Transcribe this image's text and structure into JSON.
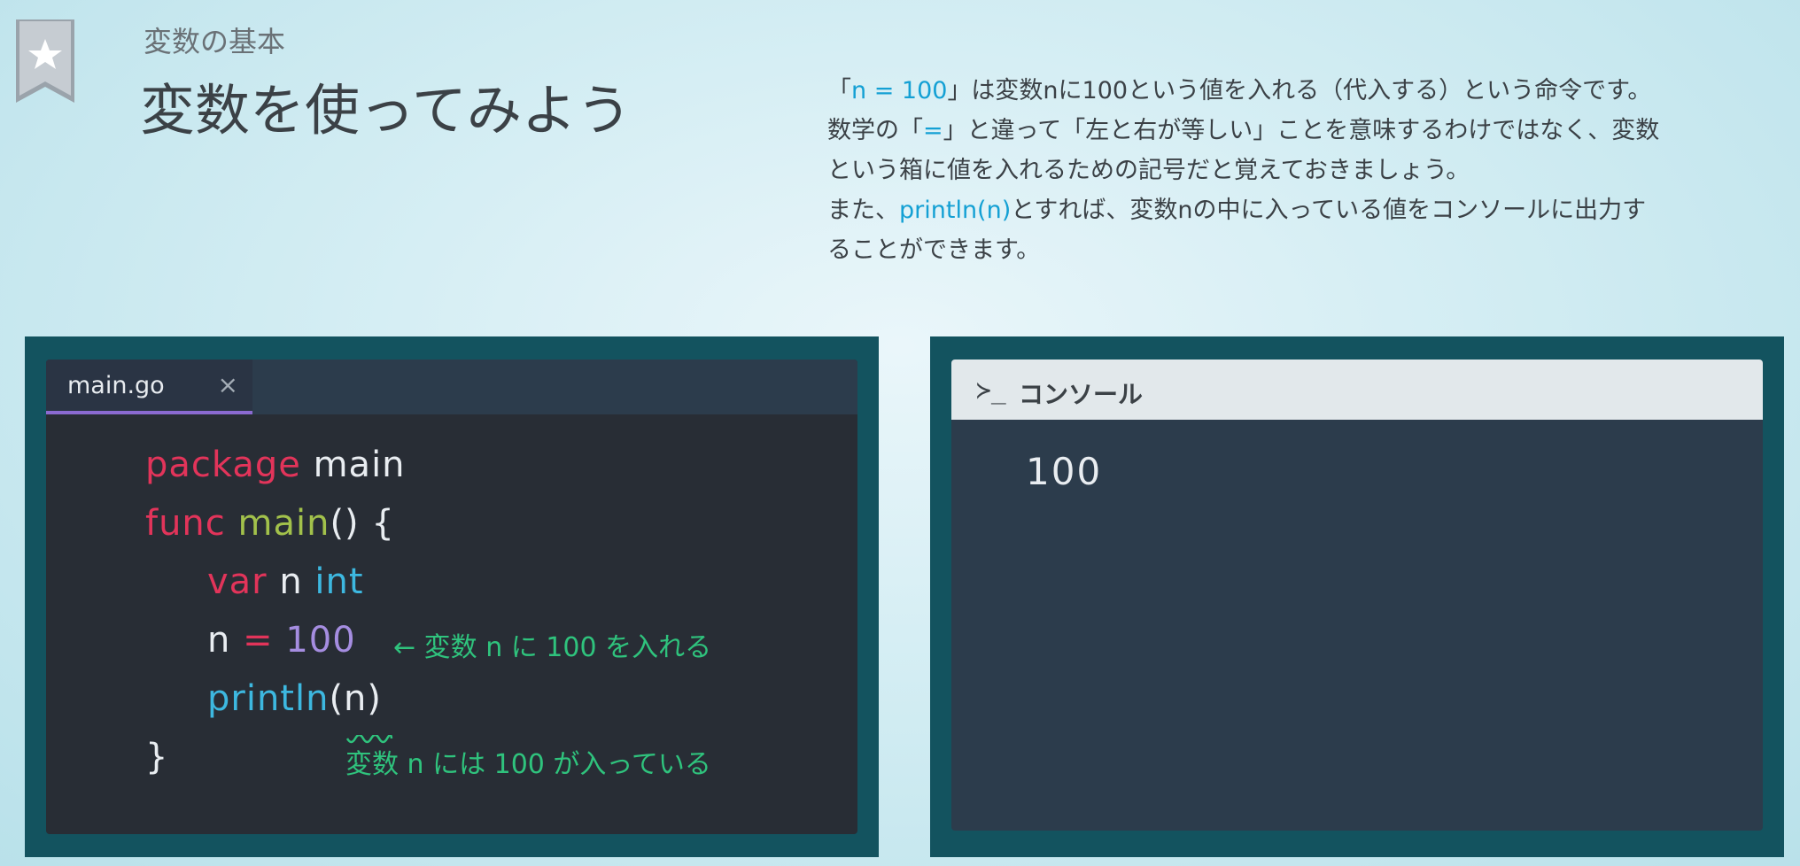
{
  "header": {
    "subtitle": "変数の基本",
    "title": "変数を使ってみよう"
  },
  "description": {
    "line1": {
      "open": "「",
      "code": "n = 100",
      "rest": "」は変数nに100という値を入れる（代入する）という命令です。"
    },
    "line2": {
      "before": "数学の「",
      "code": "=",
      "rest": "」と違って「左と右が等しい」ことを意味するわけではなく、変数"
    },
    "line3": "という箱に値を入れるための記号だと覚えておきましょう。",
    "line4": {
      "before": "また、",
      "code": "println(n)",
      "rest": "とすれば、変数nの中に入っている値をコンソールに出力す"
    },
    "line5": "ることができます。"
  },
  "editor": {
    "tab_label": "main.go",
    "tab_close": "×",
    "code": {
      "l1_kw": "package",
      "l1_rest": " main",
      "l2_kw": "func",
      "l2_fn": " main",
      "l2_rest": "() {",
      "l3_kw": "var",
      "l3_mid": " n ",
      "l3_type": "int",
      "l4_var": "n",
      "l4_op": " = ",
      "l4_num": "100",
      "l5_fn": "println",
      "l5_rest": "(n)",
      "l6": "}"
    },
    "annotations": {
      "assign_note": "← 変数 n に 100 を入れる",
      "value_note": "変数 n には 100 が入っている"
    }
  },
  "console": {
    "prompt": "≻_",
    "title": "コンソール",
    "output": "100"
  },
  "colors": {
    "keyword": "#e2345a",
    "function": "#a2c14b",
    "type": "#3db8e0",
    "number": "#a58de0",
    "annotation": "#2fc37d",
    "highlight": "#14a0d4",
    "tab_underline": "#8b6ad1"
  }
}
